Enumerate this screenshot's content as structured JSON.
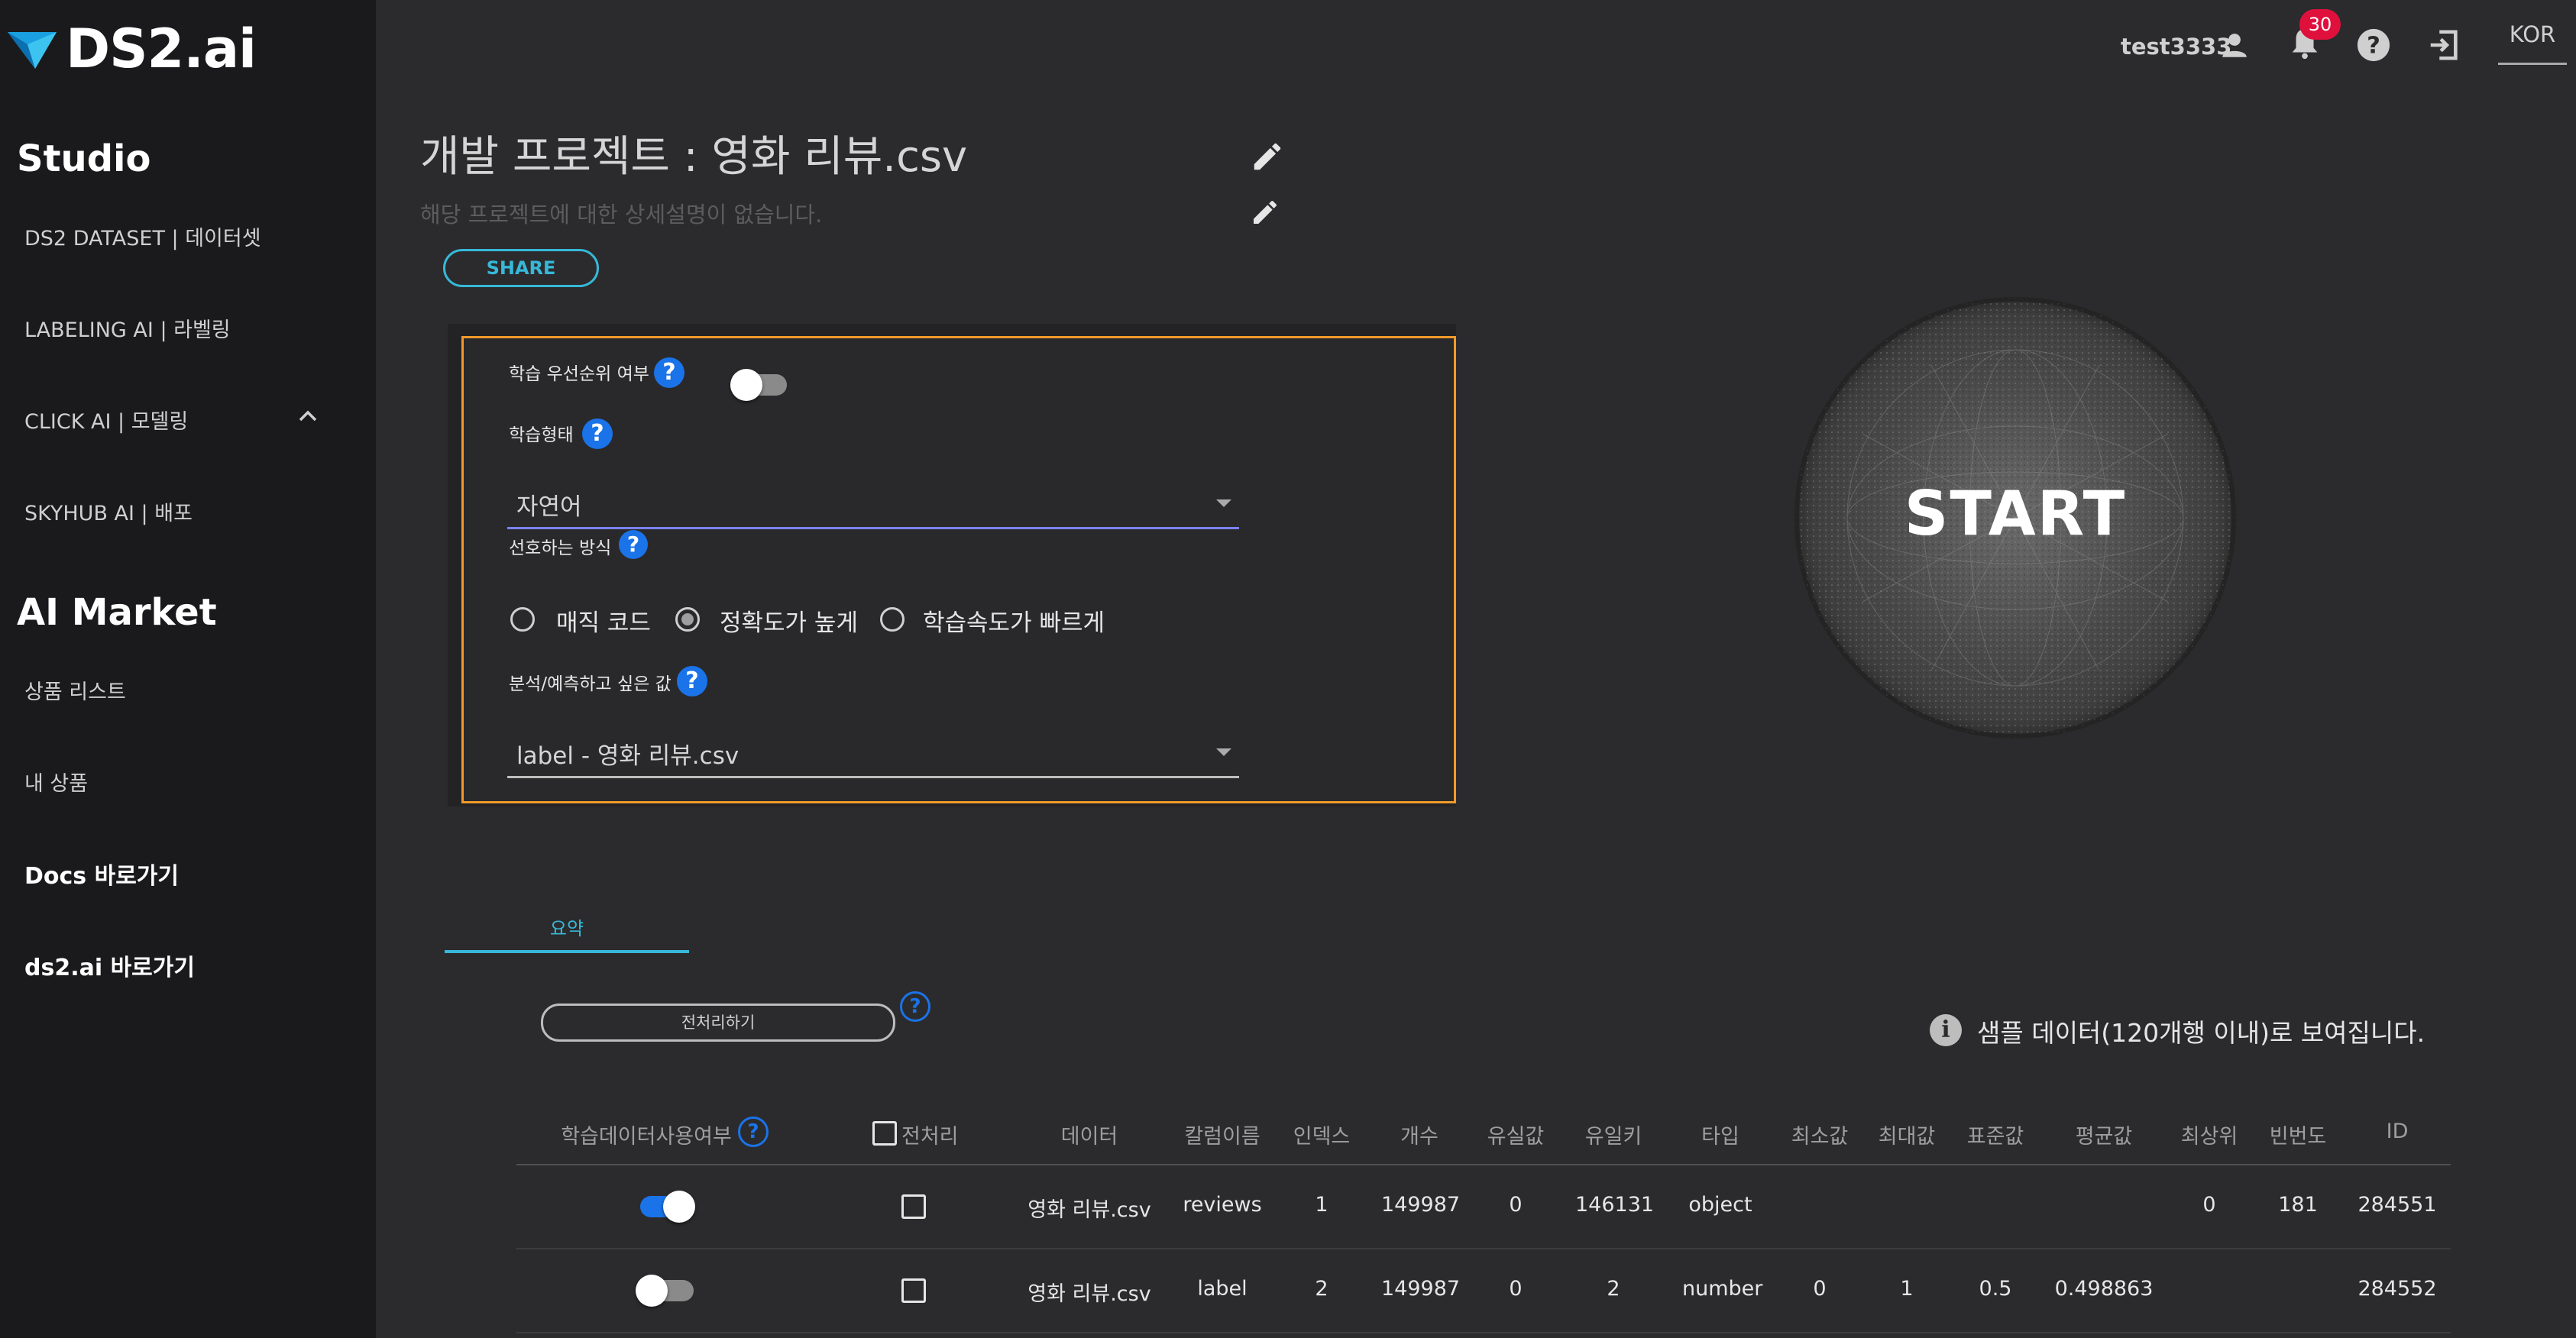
{
  "app": {
    "logo_text": "DS2.ai"
  },
  "sidebar": {
    "studio_title": "Studio",
    "studio_items": [
      {
        "label": "DS2 DATASET | 데이터셋"
      },
      {
        "label": "LABELING AI | 라벨링"
      },
      {
        "label": "CLICK AI | 모델링"
      },
      {
        "label": "SKYHUB AI | 배포"
      }
    ],
    "market_title": "AI Market",
    "market_items": [
      {
        "label": "상품 리스트"
      },
      {
        "label": "내 상품"
      }
    ],
    "links": [
      {
        "label": "Docs 바로가기"
      },
      {
        "label": "ds2.ai 바로가기"
      }
    ]
  },
  "topbar": {
    "username": "test3333",
    "notification_count": "30",
    "language": "KOR"
  },
  "project": {
    "title": "개발 프로젝트 : 영화 리뷰.csv",
    "description": "해당 프로젝트에 대한 상세설명이 없습니다.",
    "share_label": "SHARE"
  },
  "settings": {
    "priority_label": "학습 우선순위 여부",
    "priority_on": false,
    "training_type_label": "학습형태",
    "training_type_value": "자연어",
    "method_label": "선호하는 방식",
    "methods": [
      {
        "label": "매직 코드",
        "selected": false
      },
      {
        "label": "정확도가 높게",
        "selected": true
      },
      {
        "label": "학습속도가 빠르게",
        "selected": false
      }
    ],
    "target_label": "분석/예측하고 싶은 값",
    "target_value": "label - 영화 리뷰.csv",
    "help_glyph": "?"
  },
  "start": {
    "label": "START"
  },
  "summary": {
    "tab_label": "요약",
    "preprocess_button": "전처리하기",
    "sample_note": "샘플 데이터(120개행 이내)로 보여집니다.",
    "info_glyph": "i"
  },
  "table": {
    "headers": {
      "use": "학습데이터사용여부",
      "preprocess": "전처리",
      "data": "데이터",
      "column": "칼럼이름",
      "index": "인덱스",
      "count": "개수",
      "missing": "유실값",
      "unique": "유일키",
      "type": "타입",
      "min": "최소값",
      "max": "최대값",
      "std": "표준값",
      "mean": "평균값",
      "top": "최상위",
      "freq": "빈번도",
      "id": "ID"
    },
    "rows": [
      {
        "use": true,
        "preprocess": false,
        "data": "영화 리뷰.csv",
        "column": "reviews",
        "index": "1",
        "count": "149987",
        "missing": "0",
        "unique": "146131",
        "type": "object",
        "min": "",
        "max": "",
        "std": "",
        "mean": "",
        "top": "0",
        "freq": "181",
        "id": "284551"
      },
      {
        "use": false,
        "preprocess": false,
        "data": "영화 리뷰.csv",
        "column": "label",
        "index": "2",
        "count": "149987",
        "missing": "0",
        "unique": "2",
        "type": "number",
        "min": "0",
        "max": "1",
        "std": "0.5",
        "mean": "0.498863",
        "top": "",
        "freq": "",
        "id": "284552"
      }
    ]
  },
  "colors": {
    "accent": "#37b8d8",
    "panel_border": "#f09a2a",
    "help_blue": "#1a73e8",
    "badge_red": "#e0103d",
    "toggle_on": "#1a73e8"
  }
}
